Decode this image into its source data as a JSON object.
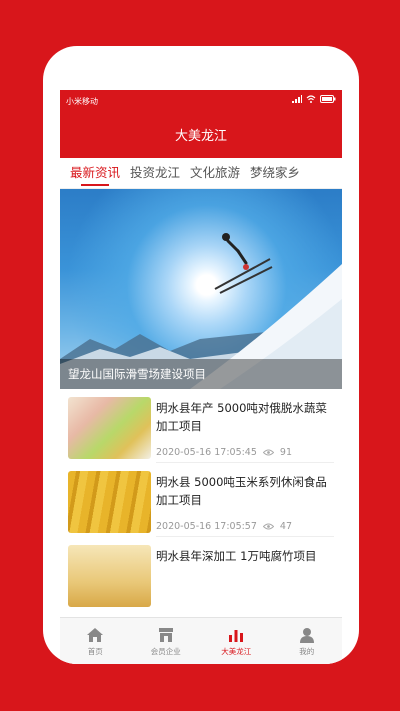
{
  "status": {
    "carrier": "小米移动"
  },
  "header": {
    "title": "大美龙江"
  },
  "tabs": [
    {
      "label": "最新资讯",
      "active": true
    },
    {
      "label": "投资龙江",
      "active": false
    },
    {
      "label": "文化旅游",
      "active": false
    },
    {
      "label": "梦绕家乡",
      "active": false
    }
  ],
  "hero": {
    "caption": "望龙山国际滑雪场建设项目"
  },
  "news": [
    {
      "title": "明水县年产 5000吨对俄脱水蔬菜加工项目",
      "date": "2020-05-16 17:05:45",
      "views": "91"
    },
    {
      "title": "明水县 5000吨玉米系列休闲食品加工项目",
      "date": "2020-05-16 17:05:57",
      "views": "47"
    },
    {
      "title": "明水县年深加工 1万吨腐竹项目",
      "date": "",
      "views": ""
    }
  ],
  "tabbar": [
    {
      "label": "首页",
      "icon": "home-icon",
      "active": false
    },
    {
      "label": "会员企业",
      "icon": "store-icon",
      "active": false
    },
    {
      "label": "大美龙江",
      "icon": "bar-chart-icon",
      "active": true
    },
    {
      "label": "我的",
      "icon": "user-icon",
      "active": false
    }
  ],
  "colors": {
    "accent": "#d8161b",
    "text": "#222222",
    "muted": "#999999"
  }
}
